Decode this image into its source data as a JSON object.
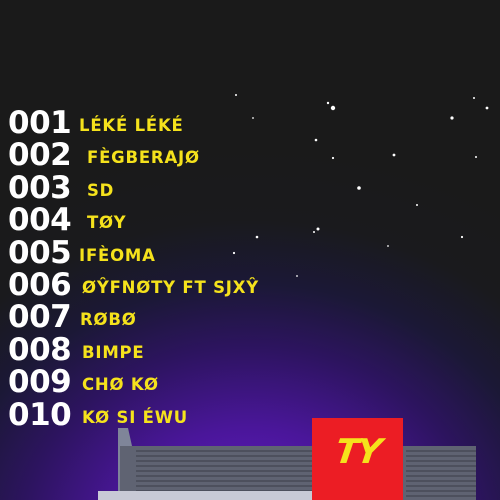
{
  "tracks": [
    {
      "number": "001",
      "title": "LÉKÉ LÉKÉ"
    },
    {
      "number": "002",
      "title": "FÈGBERAJØ"
    },
    {
      "number": "003",
      "title": "SD"
    },
    {
      "number": "004",
      "title": "TØY"
    },
    {
      "number": "005",
      "title": "IFÈOMA"
    },
    {
      "number": "006",
      "title": "ØŶFNØTY FT SJXŶ"
    },
    {
      "number": "007",
      "title": "RØBØ"
    },
    {
      "number": "008",
      "title": "BIMPE"
    },
    {
      "number": "009",
      "title": "CHØ KØ"
    },
    {
      "number": "010",
      "title": "KØ SI ÉWU"
    }
  ],
  "sign": {
    "logo": "TY"
  },
  "colors": {
    "title_yellow": "#f5e21c",
    "number_white": "#ffffff",
    "sign_red": "#ec1d24",
    "sky_purple": "#6a1fd0",
    "sky_dark": "#1a1a1a"
  }
}
